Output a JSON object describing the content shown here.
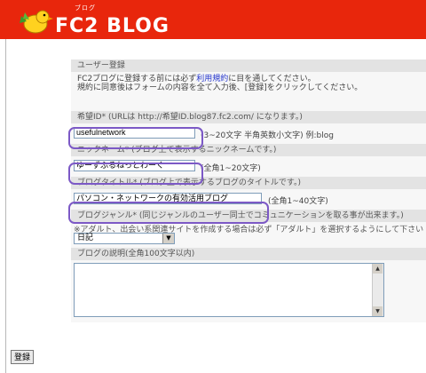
{
  "header": {
    "logo_text": "FC2 BLOG",
    "logo_ruby": "ブログ",
    "brand_color": "#e8260c"
  },
  "intro": {
    "title": "ユーザー登録",
    "line1_before": "FC2ブログに登録する前には必ず",
    "line1_link": "利用規約",
    "line1_after": "に目を通してください。",
    "line2": "規約に同意後はフォームの内容を全て入力後、[登録]をクリックしてください。"
  },
  "fields": {
    "userid": {
      "label": "希望ID* (URLは http://希望ID.blog87.fc2.com/ になります。)",
      "value": "usefulnetwork",
      "hint": "(3~20文字 半角英数小文字) 例:blog"
    },
    "nickname": {
      "label": "ニックネーム* (ブログ上で表示するニックネームです。)",
      "value": "ゆーずふるねっとわーく",
      "hint": "(全角1~20文字)"
    },
    "blog_title": {
      "label": "ブログタイトル* (ブログ上で表示するブログのタイトルです。)",
      "value": "パソコン・ネットワークの有効活用ブログ",
      "hint": "(全角1~40文字)"
    },
    "genre": {
      "label": "ブログジャンル* (同じジャンルのユーザー同士でコミュニケーションを取る事が出来ます。)",
      "notice": "※アダルト、出会い系関連サイトを作成する場合は必ず「アダルト」を選択するようにして下さい",
      "selected": "日記"
    },
    "description": {
      "label": "ブログの説明(全角100文字以内)",
      "value": ""
    }
  },
  "submit_label": "登録",
  "highlight_color": "#7c59c6"
}
